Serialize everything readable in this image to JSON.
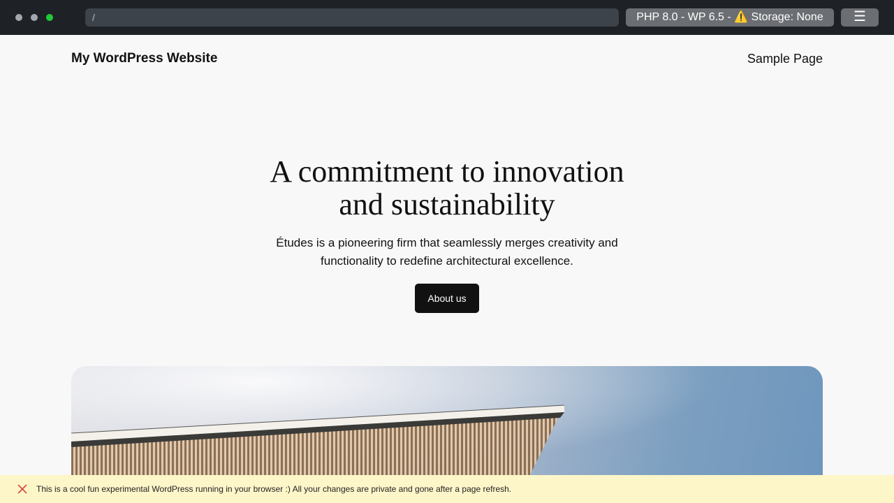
{
  "browser": {
    "url": "/",
    "env_info": "PHP 8.0 - WP 6.5 - ⚠️ Storage: None",
    "menu_icon": "☰"
  },
  "site": {
    "title": "My WordPress Website",
    "nav": [
      {
        "label": "Sample Page"
      }
    ]
  },
  "hero": {
    "heading_line1": "A commitment to innovation",
    "heading_line2": "and sustainability",
    "text_line1": "Études is a pioneering firm that seamlessly merges creativity and",
    "text_line2": "functionality to redefine architectural excellence.",
    "button_label": "About us"
  },
  "notice": {
    "text": "This is a cool fun experimental WordPress running in your browser :) All your changes are private and gone after a page refresh."
  },
  "colors": {
    "chrome_bg": "#1e2226",
    "accent_button": "#111111",
    "notice_bg": "#fdf6c9"
  }
}
